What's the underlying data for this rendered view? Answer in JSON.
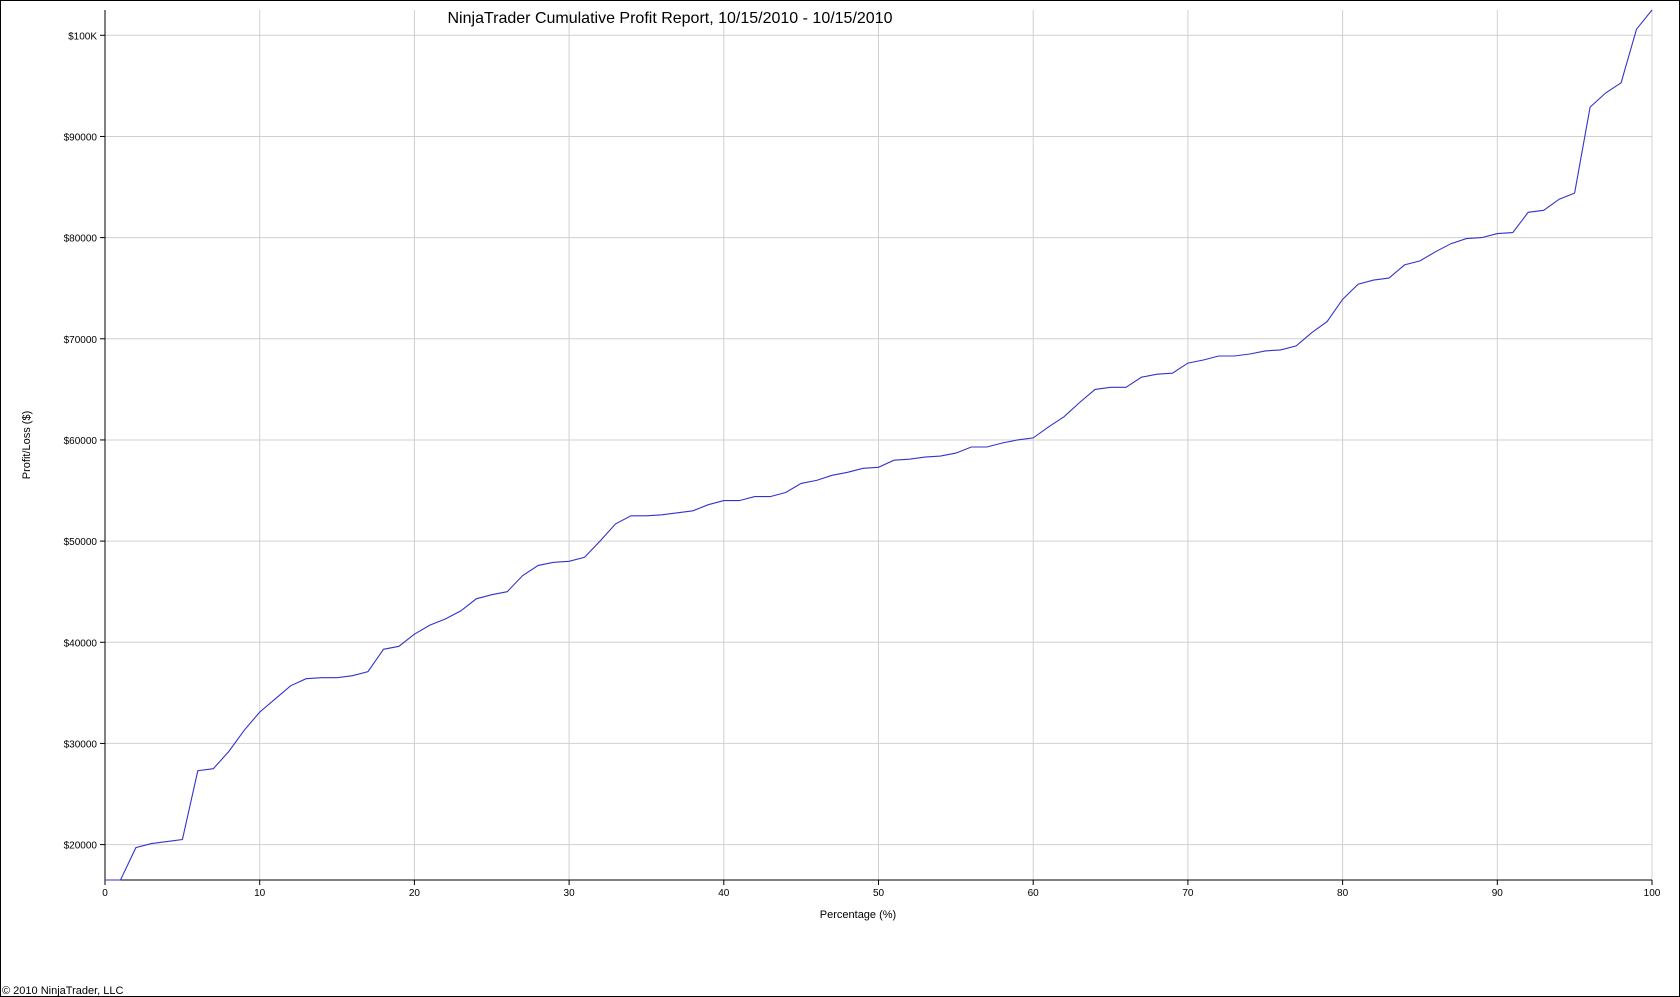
{
  "chart_data": {
    "type": "line",
    "title": "NinjaTrader Cumulative Profit Report, 10/15/2010 - 10/15/2010",
    "xlabel": "Percentage (%)",
    "ylabel": "Profit/Loss ($)",
    "xlim": [
      0,
      100
    ],
    "ylim": [
      16500,
      102500
    ],
    "grid": true,
    "x_ticks": [
      0,
      10,
      20,
      30,
      40,
      50,
      60,
      70,
      80,
      90,
      100
    ],
    "x_tick_labels": [
      "0",
      "10",
      "20",
      "30",
      "40",
      "50",
      "60",
      "70",
      "80",
      "90",
      "100"
    ],
    "y_ticks": [
      20000,
      30000,
      40000,
      50000,
      60000,
      70000,
      80000,
      90000,
      100000
    ],
    "y_tick_labels": [
      "$20000",
      "$30000",
      "$40000",
      "$50000",
      "$60000",
      "$70000",
      "$80000",
      "$90000",
      "$100K"
    ],
    "line_color": "#3333cc",
    "grid_color": "#d0d0d0",
    "series": [
      {
        "x": [
          0,
          1,
          2,
          3,
          4,
          5,
          6,
          7,
          8,
          9,
          10,
          11,
          12,
          13,
          14,
          15,
          16,
          17,
          18,
          19,
          20,
          21,
          22,
          23,
          24,
          25,
          26,
          27,
          28,
          29,
          30,
          31,
          32,
          33,
          34,
          35,
          36,
          37,
          38,
          39,
          40,
          41,
          42,
          43,
          44,
          45,
          46,
          47,
          48,
          49,
          50,
          51,
          52,
          53,
          54,
          55,
          56,
          57,
          58,
          59,
          60,
          61,
          62,
          63,
          64,
          65,
          66,
          67,
          68,
          69,
          70,
          71,
          72,
          73,
          74,
          75,
          76,
          77,
          78,
          79,
          80,
          81,
          82,
          83,
          84,
          85,
          86,
          87,
          88,
          89,
          90,
          91,
          92,
          93,
          94,
          95,
          96,
          97,
          98,
          99,
          100
        ],
        "y": [
          16500,
          16500,
          19700,
          20100,
          20300,
          20500,
          27300,
          27500,
          29200,
          31300,
          33100,
          34400,
          35700,
          36400,
          36500,
          36500,
          36700,
          37100,
          39300,
          39600,
          40800,
          41700,
          42300,
          43100,
          44300,
          44700,
          45000,
          46600,
          47600,
          47900,
          48000,
          48400,
          50000,
          51700,
          52500,
          52500,
          52600,
          52800,
          53000,
          53600,
          54000,
          54000,
          54400,
          54400,
          54800,
          55700,
          56000,
          56500,
          56800,
          57200,
          57300,
          58000,
          58100,
          58300,
          58400,
          58700,
          59300,
          59300,
          59700,
          60000,
          60200,
          61300,
          62300,
          63700,
          65000,
          65200,
          65200,
          66200,
          66500,
          66600,
          67600,
          67900,
          68300,
          68300,
          68500,
          68800,
          68900,
          69300,
          70600,
          71700,
          73900,
          75400,
          75800,
          76000,
          77300,
          77700,
          78600,
          79400,
          79900,
          80000,
          80400,
          80500,
          82500,
          82700,
          83800,
          84400,
          92900,
          94300,
          95300,
          100600,
          102500
        ]
      }
    ]
  },
  "copyright": "© 2010 NinjaTrader, LLC"
}
